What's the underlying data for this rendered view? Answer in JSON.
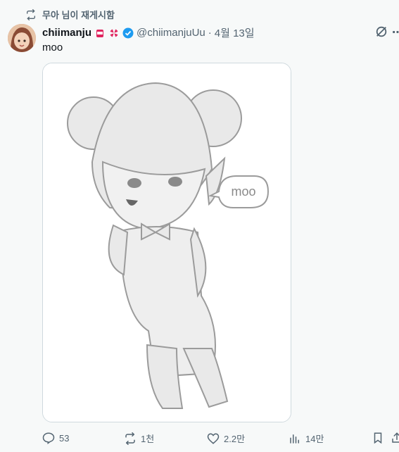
{
  "retweet": {
    "text": "무아 님이 재게시함"
  },
  "tweet": {
    "author_name": "chiimanju",
    "handle": "@chiimanjuUu",
    "separator": "·",
    "date": "4월 13일",
    "text": "moo",
    "media": {
      "speech_bubble": "moo"
    }
  },
  "actions": {
    "replies": "53",
    "reposts": "1천",
    "likes": "2.2만",
    "views": "14만"
  },
  "colors": {
    "verified": "#1d9bf0",
    "secondary_text": "#536471",
    "background": "#f7f9f9"
  }
}
